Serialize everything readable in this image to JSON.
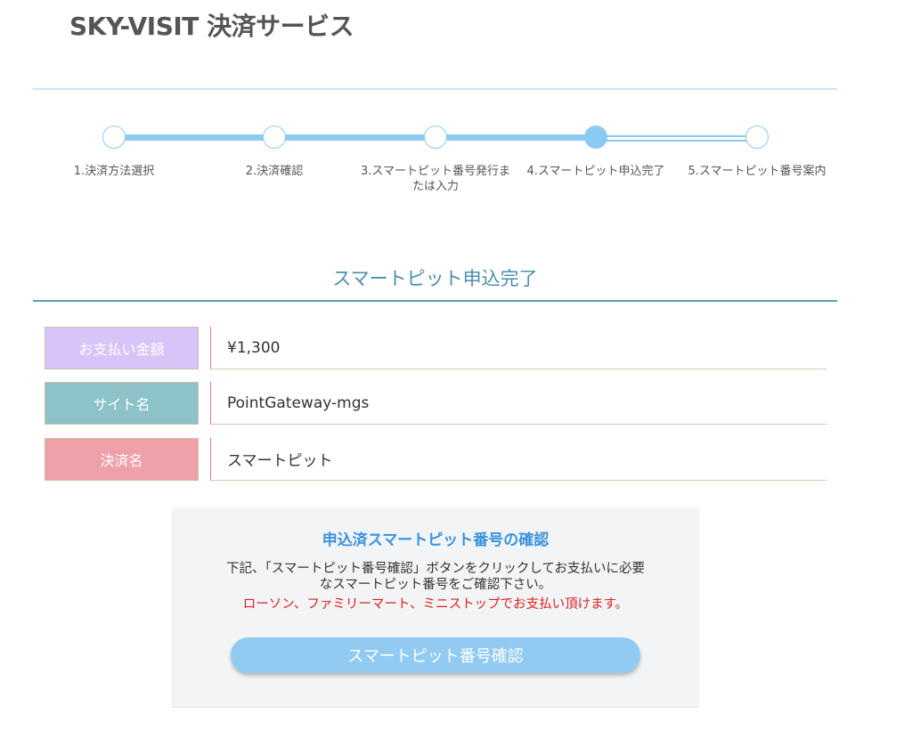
{
  "header": {
    "title": "SKY-VISIT 決済サービス"
  },
  "steps": {
    "current_step": 4,
    "items": [
      {
        "label": "1.決済方法選択"
      },
      {
        "label": "2.決済確認"
      },
      {
        "label": "3.スマートピット番号発行または入力"
      },
      {
        "label": "4.スマートピット申込完了"
      },
      {
        "label": "5.スマートピット番号案内"
      }
    ]
  },
  "section": {
    "title": "スマートピット申込完了"
  },
  "info": {
    "rows": [
      {
        "label": "お支払い金額",
        "value": "¥1,300",
        "color": "#d8c4f7"
      },
      {
        "label": "サイト名",
        "value": "PointGateway-mgs",
        "color": "#8cc2c8"
      },
      {
        "label": "決済名",
        "value": "スマートピット",
        "color": "#f0a0a8"
      }
    ]
  },
  "confirm": {
    "title": "申込済スマートピット番号の確認",
    "description_line1": "下記、「スマートピット番号確認」ボタンをクリックしてお支払いに必要",
    "description_line2": "なスマートピット番号をご確認下さい。",
    "note": "ローソン、ファミリーマート、ミニストップでお支払い頂けます。",
    "button_label": "スマートピット番号確認"
  },
  "colors": {
    "accent": "#8ccaf2",
    "section_title": "#4a8eaa",
    "note_red": "#e02020",
    "confirm_title": "#3b94dd"
  }
}
